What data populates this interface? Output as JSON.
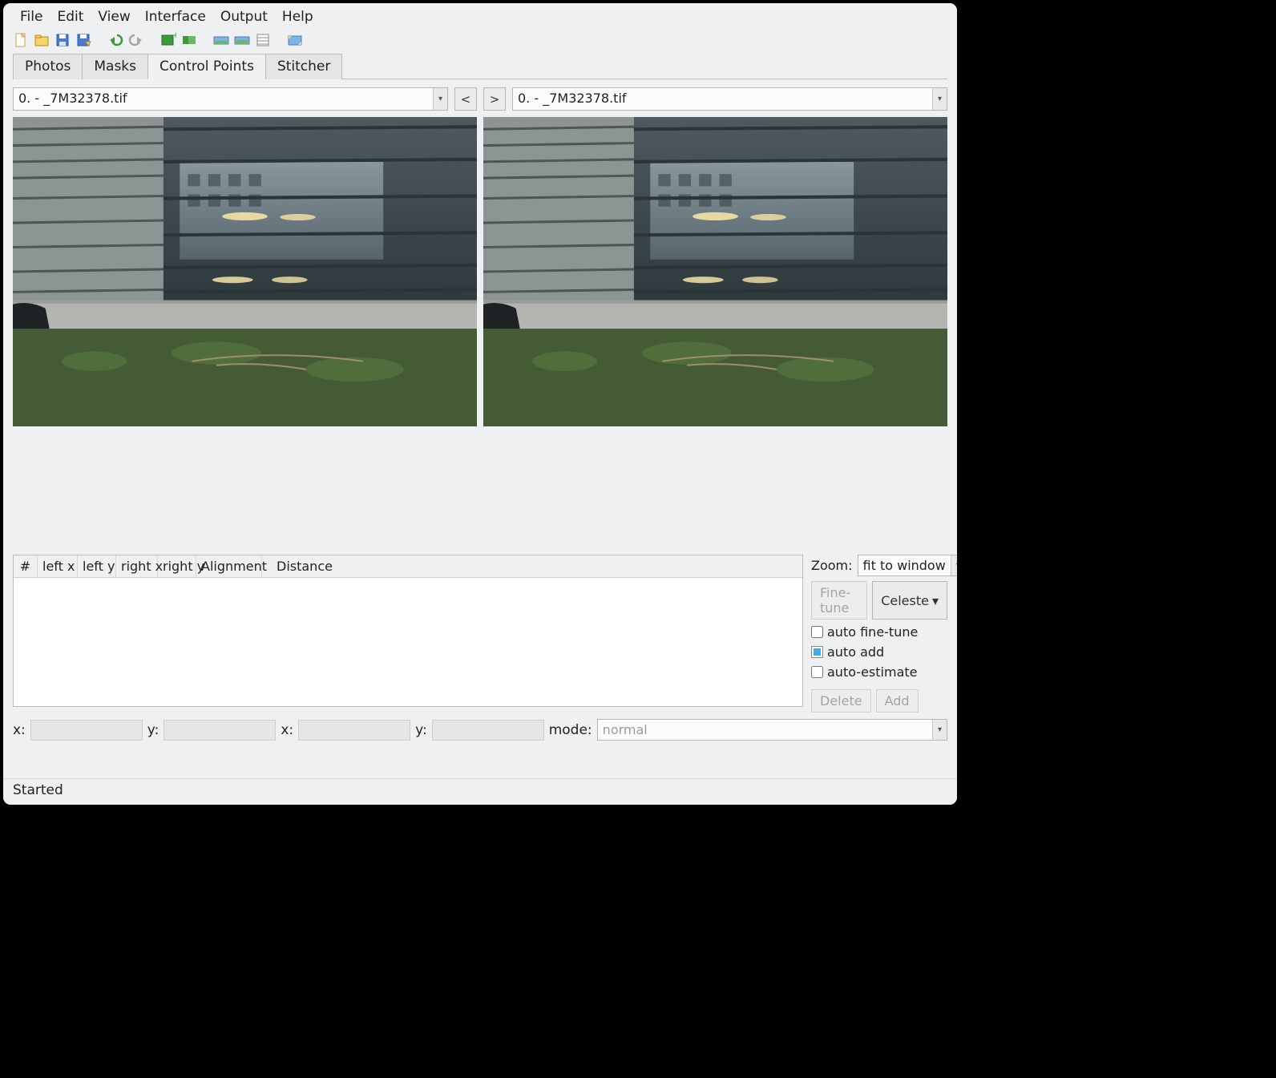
{
  "menu": {
    "file": "File",
    "edit": "Edit",
    "view": "View",
    "interface": "Interface",
    "output": "Output",
    "help": "Help"
  },
  "tabs": {
    "photos": "Photos",
    "masks": "Masks",
    "cp": "Control Points",
    "stitcher": "Stitcher"
  },
  "combo_left": "0. - _7M32378.tif",
  "combo_right": "0. - _7M32378.tif",
  "nav_prev": "<",
  "nav_next": ">",
  "table_headers": {
    "num": "#",
    "lx": "left x",
    "ly": "left y",
    "rx": "right x",
    "ry": "right y",
    "align": "Alignment",
    "dist": "Distance"
  },
  "side": {
    "zoom_label": "Zoom:",
    "zoom_value": "fit to window",
    "finetune_btn": "Fine-tune",
    "celeste_btn": "Celeste",
    "auto_finetune": "auto fine-tune",
    "auto_add": "auto add",
    "auto_estimate": "auto-estimate",
    "delete_btn": "Delete",
    "add_btn": "Add"
  },
  "coords": {
    "x1_label": "x:",
    "y1_label": "y:",
    "x2_label": "x:",
    "y2_label": "y:",
    "mode_label": "mode:",
    "mode_value": "normal"
  },
  "status": "Started"
}
